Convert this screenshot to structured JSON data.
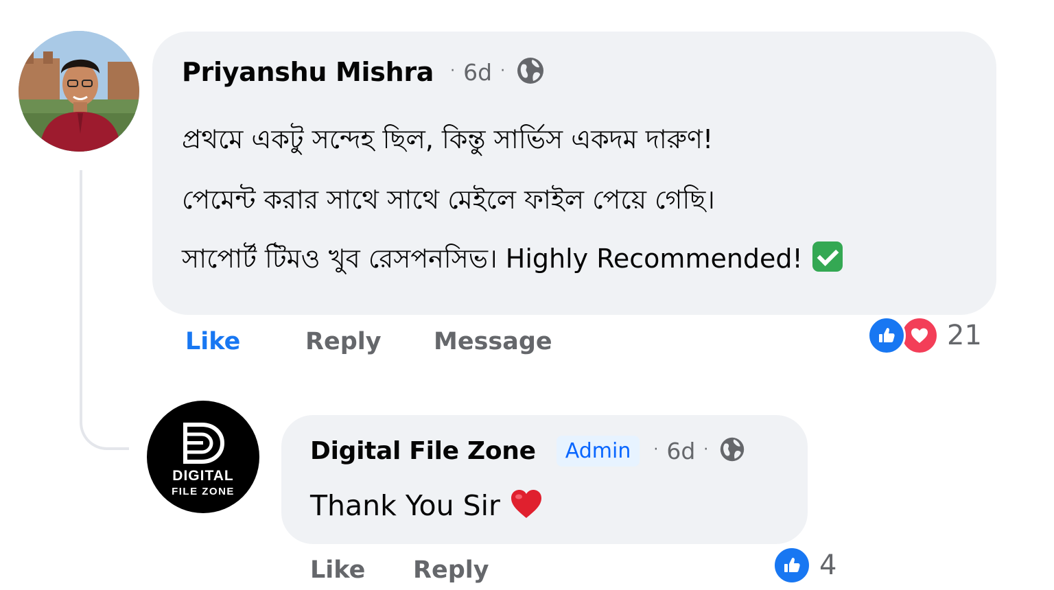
{
  "main_comment": {
    "author": "Priyanshu Mishra",
    "time": "6d",
    "separator": "·",
    "lines": [
      "প্রথমে একটু সন্দেহ ছিল, কিন্তু সার্ভিস একদম দারুণ!",
      "পেমেন্ট করার সাথে সাথে মেইলে ফাইল পেয়ে গেছি।",
      "সাপোর্ট টিমও খুব রেসপনসিভ। Highly Recommended!"
    ],
    "trailing_emoji": "check-mark-button-icon",
    "actions": {
      "like": "Like",
      "reply": "Reply",
      "message": "Message"
    },
    "like_state": "liked",
    "reactions": {
      "types": [
        "like-icon",
        "love-icon"
      ],
      "count": "21"
    }
  },
  "reply_comment": {
    "author": "Digital File Zone",
    "badge": "Admin",
    "time": "6d",
    "separator": "·",
    "text": "Thank You Sir",
    "trailing_emoji": "red-heart-icon",
    "actions": {
      "like": "Like",
      "reply": "Reply"
    },
    "reactions": {
      "types": [
        "like-icon"
      ],
      "count": "4"
    },
    "avatar_logo": {
      "line1": "DIGITAL",
      "line2": "FILE ZONE"
    }
  },
  "colors": {
    "bubble": "#f0f2f5",
    "liked_blue": "#1877f2",
    "love_red": "#f33e58",
    "muted": "#65676b",
    "admin_badge_bg": "#e7f3ff",
    "admin_badge_text": "#0866ff"
  }
}
